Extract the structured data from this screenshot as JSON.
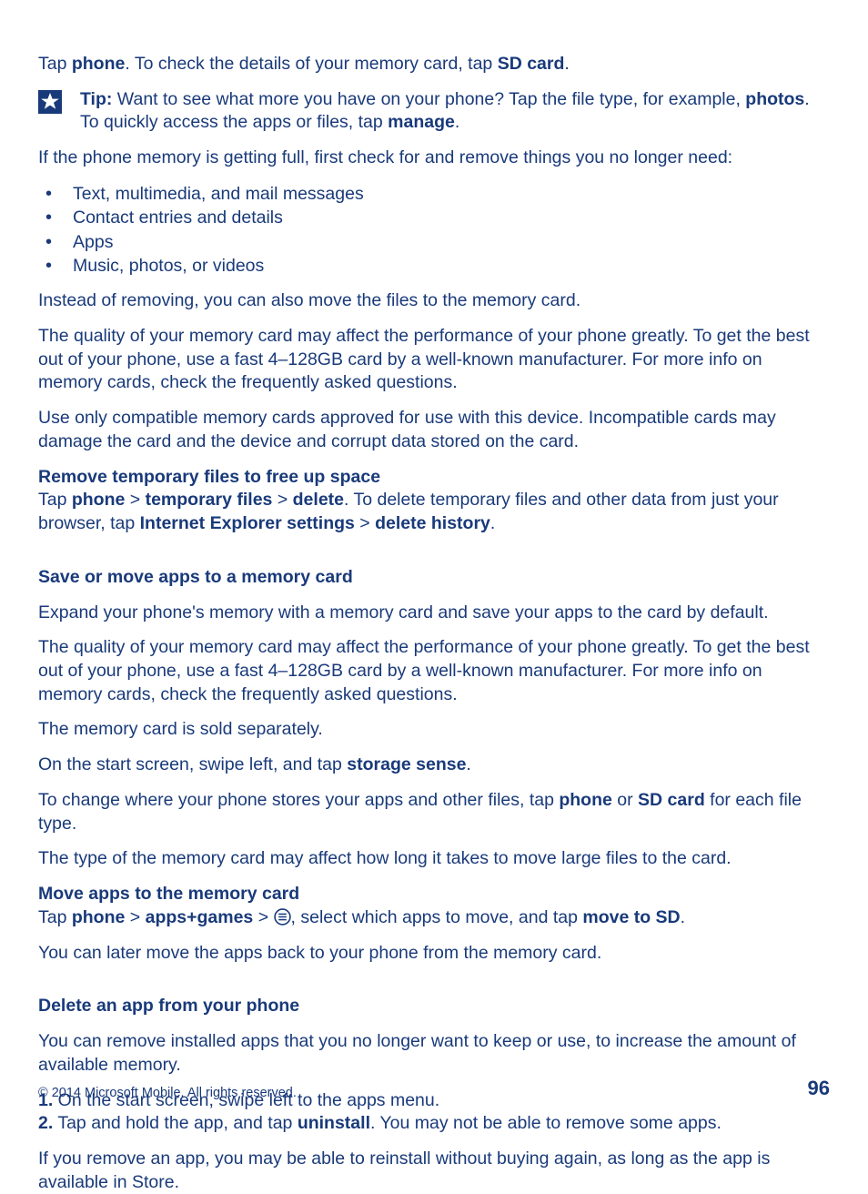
{
  "p1": {
    "t1": "Tap ",
    "b1": "phone",
    "t2": ". To check the details of your memory card, tap ",
    "b2": "SD card",
    "t3": "."
  },
  "tip": {
    "label": "Tip:",
    "t1": " Want to see what more you have on your phone? Tap the file type, for example, ",
    "b1": "photos",
    "t2": ". To quickly access the apps or files, tap ",
    "b2": "manage",
    "t3": "."
  },
  "p2": "If the phone memory is getting full, first check for and remove things you no longer need:",
  "bullets": [
    "Text, multimedia, and mail messages",
    "Contact entries and details",
    "Apps",
    "Music, photos, or videos"
  ],
  "p3": "Instead of removing, you can also move the files to the memory card.",
  "p4": "The quality of your memory card may affect the performance of your phone greatly. To get the best out of your phone, use a fast 4–128GB card by a well-known manufacturer. For more info on memory cards, check the frequently asked questions.",
  "p5": "Use only compatible memory cards approved for use with this device. Incompatible cards may damage the card and the device and corrupt data stored on the card.",
  "sec1": {
    "hdr": "Remove temporary files to free up space",
    "t1": "Tap ",
    "b1": "phone",
    "gt1": " > ",
    "b2": "temporary files",
    "gt2": " > ",
    "b3": "delete",
    "t2": ". To delete temporary files and other data from just your browser, tap ",
    "b4": "Internet Explorer settings",
    "gt3": " > ",
    "b5": "delete history",
    "t3": "."
  },
  "sec2": {
    "hdr": "Save or move apps to a memory card"
  },
  "p6": "Expand your phone's memory with a memory card and save your apps to the card by default.",
  "p7": "The quality of your memory card may affect the performance of your phone greatly. To get the best out of your phone, use a fast 4–128GB card by a well-known manufacturer. For more info on memory cards, check the frequently asked questions.",
  "p8": "The memory card is sold separately.",
  "p9": {
    "t1": "On the start screen, swipe left, and tap ",
    "b1": "storage sense",
    "t2": "."
  },
  "p10": {
    "t1": "To change where your phone stores your apps and other files, tap ",
    "b1": "phone",
    "t2": " or ",
    "b2": "SD card",
    "t3": " for each file type."
  },
  "p11": "The type of the memory card may affect how long it takes to move large files to the card.",
  "sec3": {
    "hdr": "Move apps to the memory card",
    "t1": "Tap ",
    "b1": "phone",
    "gt1": " > ",
    "b2": "apps+games",
    "gt2": " > ",
    "t2": ", select which apps to move, and tap ",
    "b3": "move to SD",
    "t3": "."
  },
  "p12": "You can later move the apps back to your phone from the memory card.",
  "sec4": {
    "hdr": "Delete an app from your phone"
  },
  "p13": "You can remove installed apps that you no longer want to keep or use, to increase the amount of available memory.",
  "steps": {
    "n1": "1.",
    "s1": " On the start screen, swipe left to the apps menu.",
    "n2": "2.",
    "s2a": " Tap and hold the app, and tap ",
    "s2b": "uninstall",
    "s2c": ". You may not be able to remove some apps."
  },
  "p14": "If you remove an app, you may be able to reinstall without buying again, as long as the app is available in Store.",
  "footer": {
    "copy": "© 2014 Microsoft Mobile. All rights reserved.",
    "page": "96"
  }
}
